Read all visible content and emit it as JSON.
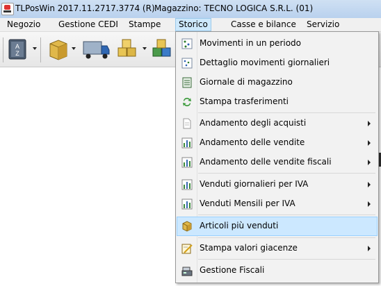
{
  "window": {
    "title": "TLPosWin 2017.11.2717.3774 (R)",
    "magazzino_label": "Magazzino:",
    "magazzino_value": "TECNO LOGICA S.R.L. (01)"
  },
  "menubar": {
    "items": [
      {
        "label": "Negozio"
      },
      {
        "label": "Gestione CEDI"
      },
      {
        "label": "Stampe"
      },
      {
        "label": "Storico"
      },
      {
        "label": "Casse e bilance"
      },
      {
        "label": "Servizio"
      }
    ]
  },
  "toolbar": {
    "buttons": [
      {
        "icon": "sort-az-icon"
      },
      {
        "icon": "package-icon"
      },
      {
        "icon": "truck-icon"
      },
      {
        "icon": "boxes-icon"
      },
      {
        "icon": "colored-boxes-icon"
      }
    ]
  },
  "storico_menu": {
    "items": [
      {
        "label": "Movimenti in un periodo",
        "icon": "movements-icon",
        "submenu": false
      },
      {
        "label": "Dettaglio movimenti giornalieri",
        "icon": "daily-detail-icon",
        "submenu": false
      },
      {
        "label": "Giornale di magazzino",
        "icon": "journal-icon",
        "submenu": false
      },
      {
        "label": "Stampa trasferimenti",
        "icon": "transfer-icon",
        "submenu": false
      },
      {
        "label": "Andamento degli acquisti",
        "icon": "document-icon",
        "submenu": true
      },
      {
        "label": "Andamento delle vendite",
        "icon": "bar-chart-icon",
        "submenu": true
      },
      {
        "label": "Andamento delle vendite fiscali",
        "icon": "bar-chart-icon",
        "submenu": true
      },
      {
        "label": "Venduti giornalieri per IVA",
        "icon": "bar-chart-icon",
        "submenu": true
      },
      {
        "label": "Venduti Mensili per IVA",
        "icon": "bar-chart-icon",
        "submenu": true
      },
      {
        "label": "Articoli più venduti",
        "icon": "package-icon",
        "submenu": false,
        "highlighted": true
      },
      {
        "label": "Stampa valori giacenze",
        "icon": "stock-values-icon",
        "submenu": true
      },
      {
        "label": "Gestione Fiscali",
        "icon": "cash-register-icon",
        "submenu": false
      }
    ]
  },
  "colors": {
    "titlebar": "#b9d1ee",
    "menubar": "#f0f0f0",
    "menu_highlight": "#cce8ff",
    "menu_border": "#979797"
  }
}
